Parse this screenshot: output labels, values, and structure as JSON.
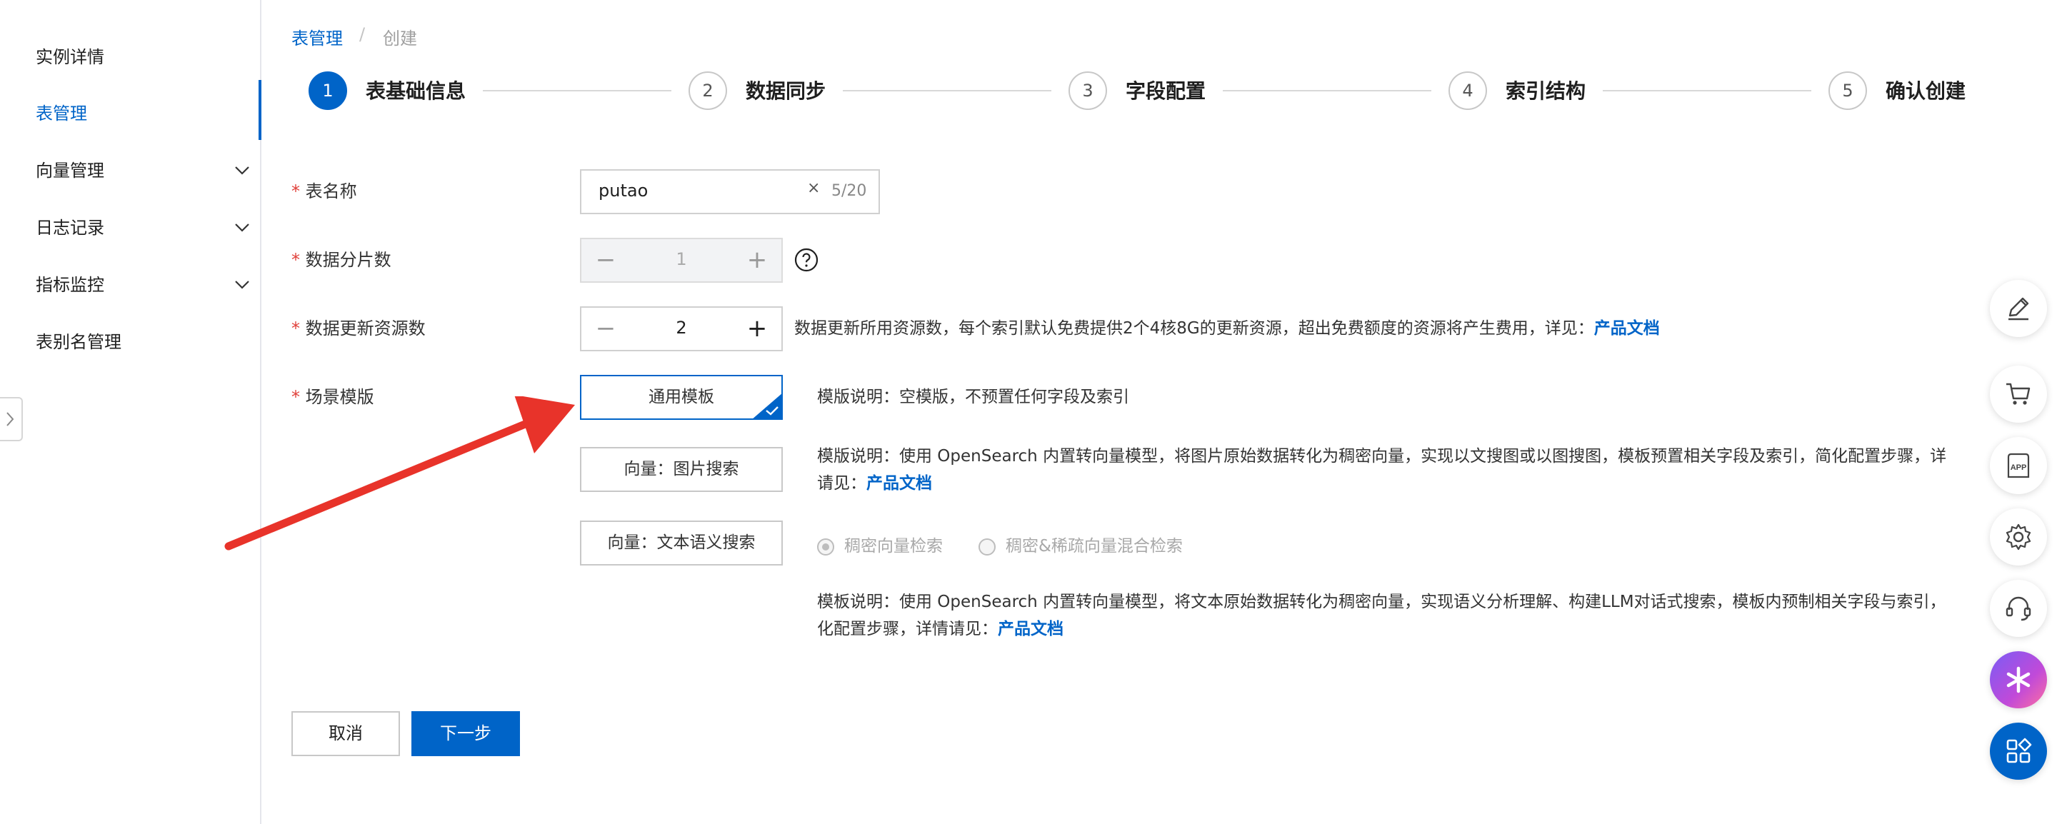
{
  "sidebar": {
    "items": [
      {
        "label": "实例详情",
        "active": false,
        "expandable": false
      },
      {
        "label": "表管理",
        "active": true,
        "expandable": false
      },
      {
        "label": "向量管理",
        "active": false,
        "expandable": true
      },
      {
        "label": "日志记录",
        "active": false,
        "expandable": true
      },
      {
        "label": "指标监控",
        "active": false,
        "expandable": true
      },
      {
        "label": "表别名管理",
        "active": false,
        "expandable": false
      }
    ]
  },
  "breadcrumb": {
    "root": "表管理",
    "separator": "/",
    "current": "创建"
  },
  "steps": [
    {
      "num": "1",
      "label": "表基础信息",
      "active": true
    },
    {
      "num": "2",
      "label": "数据同步",
      "active": false
    },
    {
      "num": "3",
      "label": "字段配置",
      "active": false
    },
    {
      "num": "4",
      "label": "索引结构",
      "active": false
    },
    {
      "num": "5",
      "label": "确认创建",
      "active": false
    }
  ],
  "form": {
    "required_mark": "*",
    "table_name": {
      "label": "表名称",
      "value": "putao",
      "clear": "×",
      "count": "5/20"
    },
    "shards": {
      "label": "数据分片数",
      "value": "1",
      "minus": "−",
      "plus": "+",
      "disabled": true
    },
    "update_resources": {
      "label": "数据更新资源数",
      "value": "2",
      "minus": "−",
      "plus": "+",
      "desc": "数据更新所用资源数，每个索引默认免费提供2个4核8G的更新资源，超出免费额度的资源将产生费用，详见：",
      "link": "产品文档"
    },
    "scene_template": {
      "label": "场景模版",
      "options": [
        {
          "label": "通用模板",
          "selected": true,
          "desc": "模版说明：空模版，不预置任何字段及索引"
        },
        {
          "label": "向量：图片搜索",
          "selected": false,
          "desc_line1": "模版说明：使用 OpenSearch 内置转向量模型，将图片原始数据转化为稠密向量，实现以文搜图或以图搜图，模板预置相关字段及索引，简化配置步骤，详",
          "desc_line2": "请见：",
          "link": "产品文档"
        },
        {
          "label": "向量：文本语义搜索",
          "selected": false,
          "desc_line1": "模板说明：使用 OpenSearch 内置转向量模型，将文本原始数据转化为稠密向量，实现语义分析理解、构建LLM对话式搜索，模板内预制相关字段与索引，",
          "desc_line2": "化配置步骤，详情请见：",
          "link": "产品文档"
        }
      ],
      "radios": [
        {
          "label": "稠密向量检索",
          "checked": true
        },
        {
          "label": "稠密&稀疏向量混合检索",
          "checked": false
        }
      ]
    }
  },
  "actions": {
    "cancel": "取消",
    "next": "下一步"
  },
  "floating_tools": [
    "edit-icon",
    "cart-icon",
    "app-icon",
    "gear-icon",
    "headset-icon",
    "ai-assistant-icon",
    "apps-grid-icon"
  ],
  "colors": {
    "primary": "#0064c8",
    "required": "#e0403a",
    "annotation_arrow": "#e8332a"
  }
}
